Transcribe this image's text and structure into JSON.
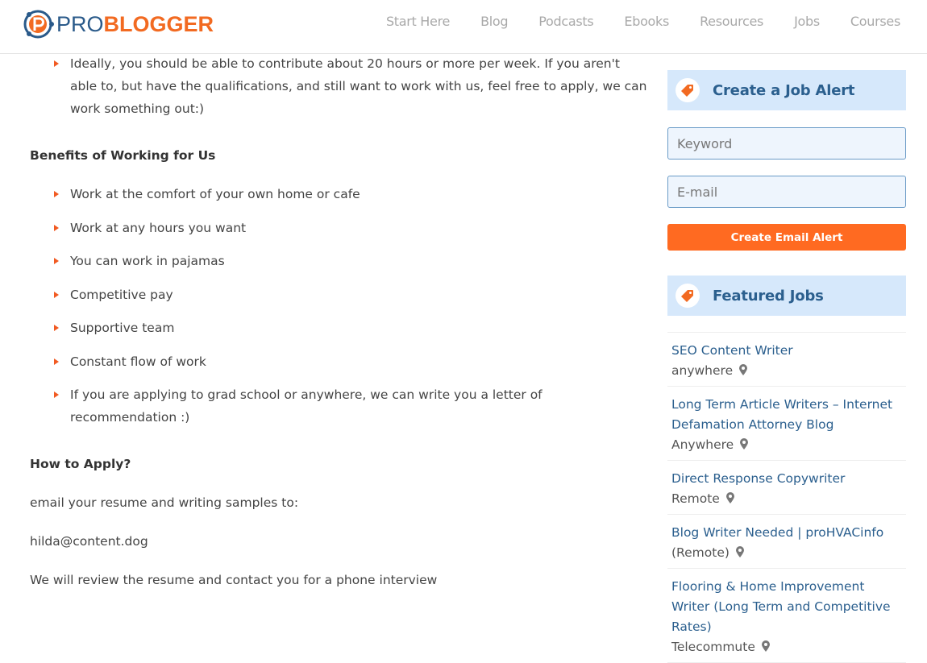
{
  "header": {
    "logo": {
      "pro": "PRO",
      "blogger": "BLOGGER"
    },
    "nav": [
      "Start Here",
      "Blog",
      "Podcasts",
      "Ebooks",
      "Resources",
      "Jobs",
      "Courses"
    ]
  },
  "main": {
    "requirements_tail": [
      "Ideally, you should be able to contribute about 20 hours or more per week. If you aren't able to, but have the qualifications, and still want to work with us, feel free to apply, we can work something out:)"
    ],
    "benefits_heading": "Benefits of Working for Us",
    "benefits": [
      "Work at the comfort of your own home or cafe",
      "Work at any hours you want",
      "You can work in pajamas",
      "Competitive pay",
      "Supportive team",
      "Constant flow of work",
      "If you are applying to grad school or anywhere, we can write you a letter of recommendation :)"
    ],
    "apply_heading": "How to Apply?",
    "apply_text": "email your resume and writing samples to:",
    "email": "hilda@content.dog",
    "closing": "We will review the resume and contact you for a phone interview"
  },
  "sidebar": {
    "alert": {
      "title": "Create a Job Alert",
      "keyword_placeholder": "Keyword",
      "email_placeholder": "E-mail",
      "button": "Create Email Alert"
    },
    "featured": {
      "title": "Featured Jobs",
      "jobs": [
        {
          "title": "SEO Content Writer",
          "location": "anywhere"
        },
        {
          "title": "Long Term Article Writers – Internet Defamation Attorney Blog",
          "location": "Anywhere"
        },
        {
          "title": "Direct Response Copywriter",
          "location": "Remote"
        },
        {
          "title": "Blog Writer Needed | proHVACinfo",
          "location": "(Remote)"
        },
        {
          "title": "Flooring & Home Improvement Writer (Long Term and Competitive Rates)",
          "location": "Telecommute"
        }
      ]
    }
  },
  "colors": {
    "accent": "#f15a22",
    "button": "#ff6a21",
    "widget_bg": "#d6e8fb",
    "link": "#2b5f8e"
  }
}
